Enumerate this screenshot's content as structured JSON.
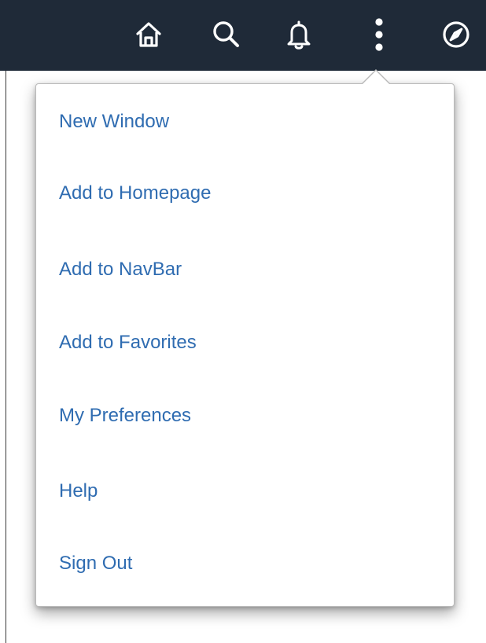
{
  "header": {
    "background_color": "#1f2a38",
    "icons": [
      {
        "name": "home-icon"
      },
      {
        "name": "search-icon"
      },
      {
        "name": "bell-icon"
      },
      {
        "name": "more-vertical-icon"
      },
      {
        "name": "compass-icon"
      }
    ]
  },
  "actions_menu": {
    "link_color": "#2f6cb1",
    "items": [
      {
        "label": "New Window"
      },
      {
        "label": "Add to Homepage"
      },
      {
        "label": "Add to NavBar"
      },
      {
        "label": "Add to Favorites"
      },
      {
        "label": "My Preferences"
      },
      {
        "label": "Help"
      },
      {
        "label": "Sign Out"
      }
    ]
  }
}
